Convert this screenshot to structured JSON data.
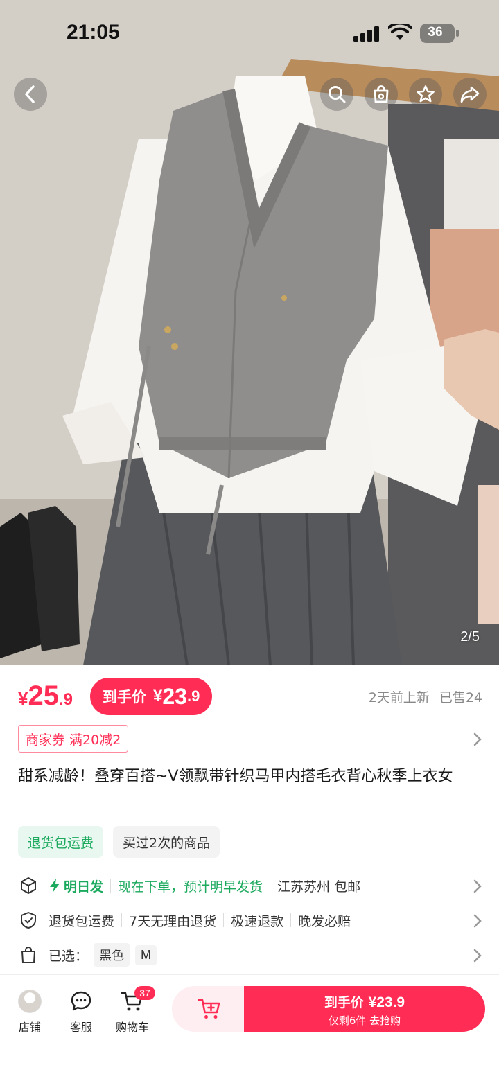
{
  "status_bar": {
    "time": "21:05",
    "battery": "36"
  },
  "gallery": {
    "page_indicator": "2/5"
  },
  "price": {
    "currency": "¥",
    "current_int": "25",
    "current_dec": ".9",
    "final_label": "到手价",
    "final_int": "23",
    "final_dec": ".9",
    "updated": "2天前上新",
    "sold": "已售24"
  },
  "coupon": {
    "label": "商家券 满20减2"
  },
  "product": {
    "title": "甜系减龄！叠穿百搭~V领飘带针织马甲内搭毛衣背心秋季上衣女"
  },
  "tags": [
    {
      "label": "退货包运费"
    },
    {
      "label": "买过2次的商品"
    }
  ],
  "shipping": {
    "fast_label": "明日发",
    "eta": "现在下单，预计明早发货",
    "origin": "江苏苏州 包邮"
  },
  "service": {
    "items": [
      "退货包运费",
      "7天无理由退货",
      "极速退款",
      "晚发必赔"
    ]
  },
  "selection": {
    "label": "已选：",
    "color": "黑色",
    "size": "M"
  },
  "bottom_nav": {
    "shop": "店铺",
    "service": "客服",
    "cart": "购物车",
    "cart_count": "37"
  },
  "buy_button": {
    "line1_label": "到手价",
    "line1_amount": "¥23.9",
    "line2": "仅剩6件 去抢购"
  },
  "colors": {
    "accent": "#ff2d55",
    "green": "#1aa95d"
  }
}
